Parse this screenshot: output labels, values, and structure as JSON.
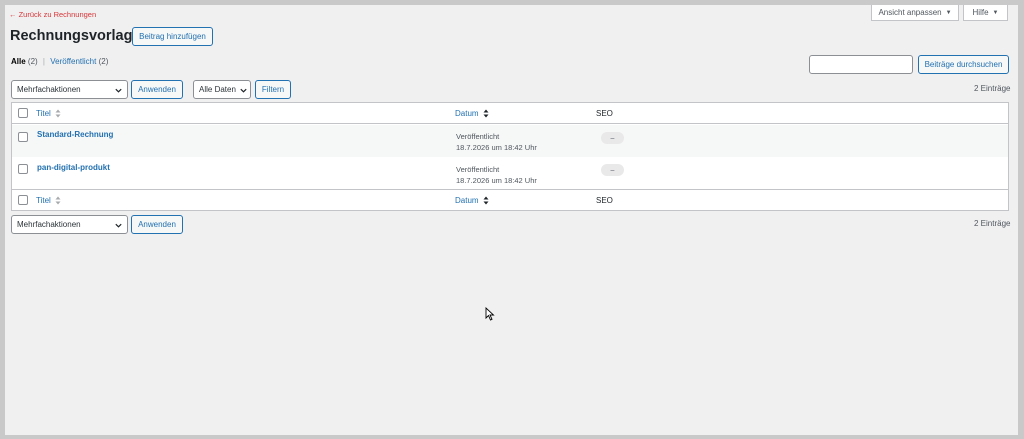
{
  "header": {
    "back_link": "← Zurück zu Rechnungen",
    "screen_options": "Ansicht anpassen",
    "help": "Hilfe",
    "title": "Rechnungsvorlagen",
    "add_button": "Beitrag hinzufügen"
  },
  "views": {
    "all_label": "Alle",
    "all_count": "(2)",
    "separator": "|",
    "published_label": "Veröffentlicht",
    "published_count": "(2)"
  },
  "search": {
    "value": "",
    "button": "Beiträge durchsuchen"
  },
  "toolbar_top": {
    "bulk_select": "Mehrfachaktionen",
    "apply": "Anwenden",
    "date_select": "Alle Daten",
    "filter": "Filtern",
    "items_count": "2 Einträge"
  },
  "table": {
    "columns": {
      "title": "Titel",
      "date": "Datum",
      "seo": "SEO"
    },
    "rows": [
      {
        "title": "Standard-Rechnung",
        "status": "Veröffentlicht",
        "date": "18.7.2026 um 18:42 Uhr",
        "seo": "–"
      },
      {
        "title": "pan-digital-produkt",
        "status": "Veröffentlicht",
        "date": "18.7.2026 um 18:42 Uhr",
        "seo": "–"
      }
    ]
  },
  "toolbar_bottom": {
    "bulk_select": "Mehrfachaktionen",
    "apply": "Anwenden",
    "items_count": "2 Einträge"
  },
  "colors": {
    "link": "#2271b1",
    "back_link": "#d63638",
    "background": "#f0f0f1"
  }
}
